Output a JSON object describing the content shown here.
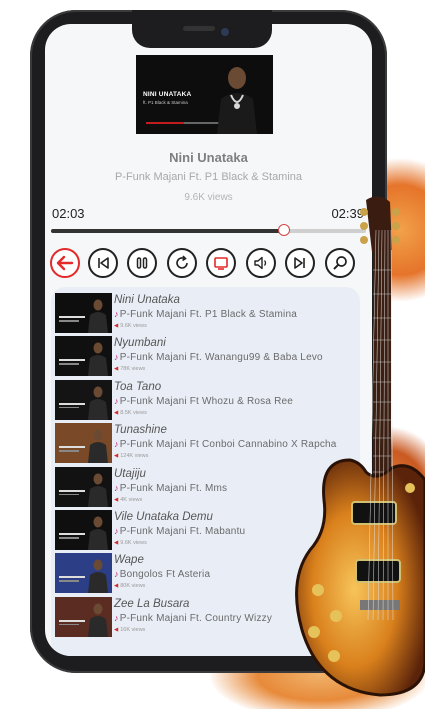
{
  "now_playing": {
    "cover_title": "NINI UNATAKA",
    "cover_subtitle": "ft. P1 Black & Stamina",
    "title": "Nini Unataka",
    "artist": "P-Funk Majani Ft. P1 Black & Stamina",
    "views": "9.6K views",
    "elapsed": "02:03",
    "duration": "02:39",
    "progress": 0.74
  },
  "controls": [
    "back-icon",
    "skip-previous-icon",
    "pause-icon",
    "repeat-icon",
    "video-icon",
    "volume-icon",
    "skip-next-icon",
    "search-icon"
  ],
  "playlist": [
    {
      "title": "Nini Unataka",
      "artist": "P-Funk Majani Ft. P1 Black & Stamina",
      "views": "9.6K views",
      "thumb": "#0e0e0e"
    },
    {
      "title": "Nyumbani",
      "artist": "P-Funk Majani Ft. Wanangu99 & Baba Levo",
      "views": "78K views",
      "thumb": "#101010"
    },
    {
      "title": "Toa Tano",
      "artist": "P-Funk Majani Ft Whozu & Rosa Ree",
      "views": "8.5K views",
      "thumb": "#141414"
    },
    {
      "title": "Tunashine",
      "artist": "P-Funk Majani Ft Conboi Cannabino X Rapcha",
      "views": "124K views",
      "thumb": "#7a4a28"
    },
    {
      "title": "Utajiju",
      "artist": "P-Funk Majani Ft. Mms",
      "views": "4K views",
      "thumb": "#121212"
    },
    {
      "title": "Vile Unataka Demu",
      "artist": "P-Funk Majani Ft. Mabantu",
      "views": "9.6K views",
      "thumb": "#0f0f0f"
    },
    {
      "title": "Wape",
      "artist": "Bongolos Ft Asteria",
      "views": "80K views",
      "thumb": "#2c3f86"
    },
    {
      "title": "Zee La Busara",
      "artist": "P-Funk Majani Ft. Country Wizzy",
      "views": "16K views",
      "thumb": "#5a2c22"
    }
  ],
  "colors": {
    "accent": "#e32929",
    "list_bg": "#e9eef6",
    "guitar_body": "#d98a1e"
  }
}
